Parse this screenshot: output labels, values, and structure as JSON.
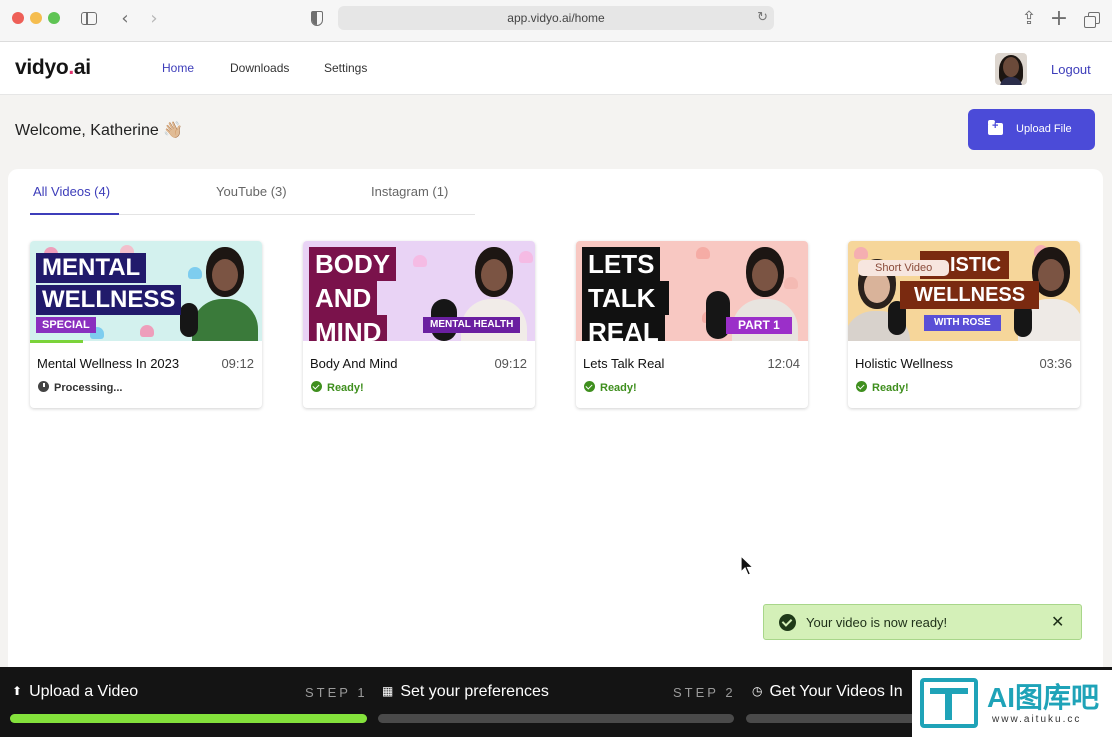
{
  "browser": {
    "url": "app.vidyo.ai/home"
  },
  "header": {
    "logo_main": "vidyo",
    "logo_dot": ".",
    "logo_tail": "ai",
    "nav": {
      "home": "Home",
      "downloads": "Downloads",
      "settings": "Settings"
    },
    "logout": "Logout"
  },
  "welcome": {
    "text": "Welcome, Katherine 👋🏼",
    "upload_label": "Upload File"
  },
  "tabs": [
    {
      "label": "All Videos (4)"
    },
    {
      "label": "YouTube (3)"
    },
    {
      "label": "Instagram (1)"
    }
  ],
  "videos": [
    {
      "title": "Mental Wellness In 2023",
      "duration": "09:12",
      "status": "Processing...",
      "thumb_lines": [
        "MENTAL",
        "WELLNESS"
      ],
      "thumb_tag": "SPECIAL",
      "progress": 0.23
    },
    {
      "title": "Body And Mind",
      "duration": "09:12",
      "status": "Ready!",
      "thumb_lines": [
        "BODY",
        "AND",
        "MIND"
      ],
      "thumb_tag": "MENTAL HEALTH"
    },
    {
      "title": "Lets Talk Real",
      "duration": "12:04",
      "status": "Ready!",
      "thumb_lines": [
        "LETS",
        "TALK",
        "REAL"
      ],
      "thumb_tag": "PART 1"
    },
    {
      "title": "Holistic Wellness",
      "duration": "03:36",
      "status": "Ready!",
      "thumb_lines": [
        "ISTIC",
        "WELLNESS"
      ],
      "thumb_tag": "WITH ROSE",
      "badge": "Short Video"
    }
  ],
  "toast": {
    "message": "Your video is now ready!"
  },
  "stepper": [
    {
      "label": "Upload a Video",
      "step": "STEP 1",
      "progress": 1.0
    },
    {
      "label": "Set your preferences",
      "step": "STEP 2",
      "progress": 0.0
    },
    {
      "label": "Get Your Videos In",
      "step": "",
      "progress": 0.0
    }
  ],
  "watermark": {
    "text": "AI图库吧",
    "url": "www.aituku.cc"
  },
  "colors": {
    "accent": "#4b4bd8",
    "ready": "#3f8f1e",
    "progress_fill": "#84e23c",
    "toast_bg": "#d4f0b8"
  }
}
